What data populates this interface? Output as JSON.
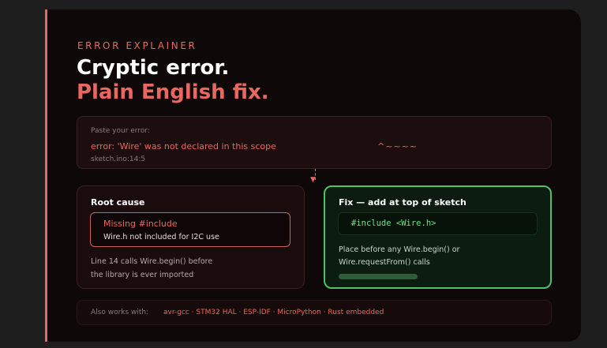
{
  "header": {
    "kicker": "ERROR EXPLAINER",
    "title_line1": "Cryptic error.",
    "title_line2": "Plain English fix."
  },
  "error_input": {
    "label": "Paste your error:",
    "message": "error: 'Wire' was not declared in this scope",
    "caret": "^~~~~",
    "location": "sketch.ino:14:5"
  },
  "root_cause": {
    "heading": "Root cause",
    "issue_title": "Missing #include",
    "issue_detail": "Wire.h not included for I2C use",
    "note": "Line 14 calls Wire.begin() before the library is ever imported"
  },
  "fix": {
    "heading": "Fix — add at top of sketch",
    "code": "#include <Wire.h>",
    "note": "Place before any Wire.begin() or Wire.requestFrom() calls"
  },
  "also_works": {
    "label": "Also works with:",
    "list": "avr-gcc · STM32 HAL · ESP-IDF · MicroPython · Rust embedded"
  },
  "colors": {
    "accent": "#e8675f",
    "success": "#4cc268",
    "background": "#0f0808"
  },
  "icons": {
    "connector": "arrow-down-icon"
  }
}
